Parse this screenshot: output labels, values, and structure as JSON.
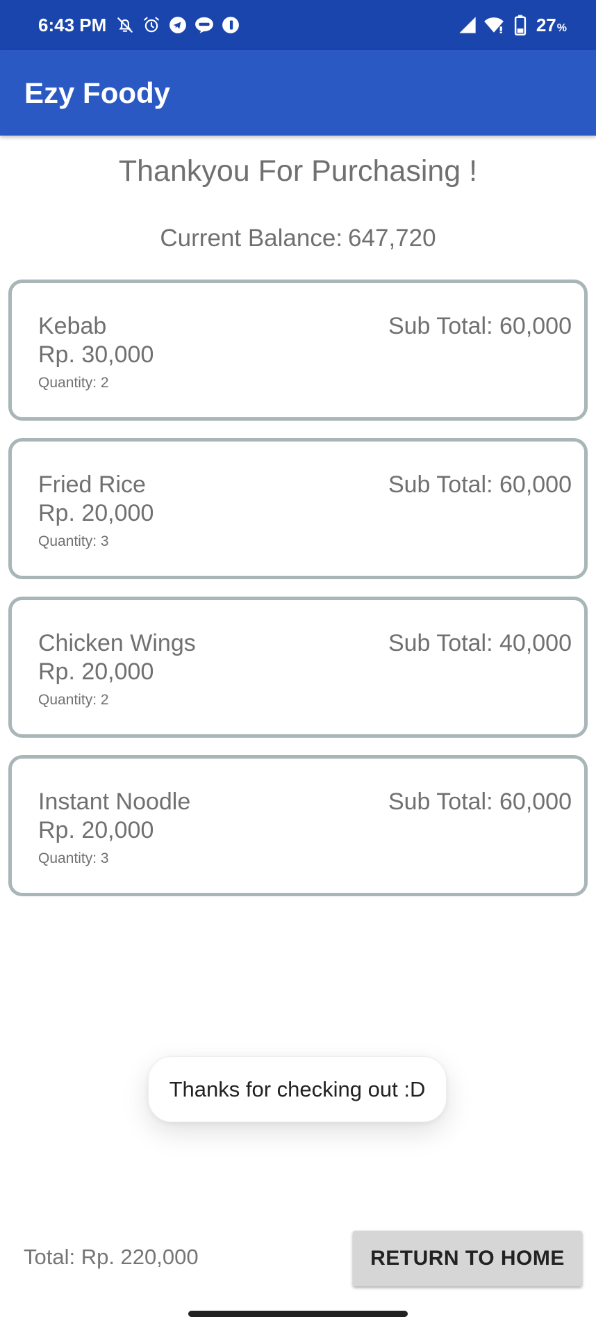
{
  "status_bar": {
    "time": "6:43 PM",
    "icons_left": [
      "bell-off-icon",
      "alarm-icon",
      "telegram-icon",
      "line-icon",
      "app-icon"
    ],
    "icons_right": [
      "signal-icon",
      "wifi-icon",
      "battery-icon"
    ],
    "battery_level": "27",
    "battery_unit": "%",
    "background": "#1a45ad"
  },
  "app_bar": {
    "title": "Ezy Foody",
    "background": "#2b59c3"
  },
  "heading": "Thankyou For Purchasing !",
  "balance": {
    "label": "Current Balance:",
    "amount": "647,720"
  },
  "items": [
    {
      "name": "Kebab",
      "price": "Rp. 30,000",
      "quantity": "Quantity: 2",
      "subtotal": "Sub Total: 60,000"
    },
    {
      "name": "Fried Rice",
      "price": "Rp. 20,000",
      "quantity": "Quantity: 3",
      "subtotal": "Sub Total: 60,000"
    },
    {
      "name": "Chicken Wings",
      "price": "Rp. 20,000",
      "quantity": "Quantity: 2",
      "subtotal": "Sub Total: 40,000"
    },
    {
      "name": "Instant Noodle",
      "price": "Rp. 20,000",
      "quantity": "Quantity: 3",
      "subtotal": "Sub Total: 60,000"
    }
  ],
  "toast": "Thanks for checking out :D",
  "footer": {
    "total": "Total: Rp. 220,000",
    "return_button": "RETURN TO HOME"
  },
  "colors": {
    "card_border": "#a9b6b8",
    "button_bg": "#d6d6d6",
    "text_gray": "#707070"
  }
}
